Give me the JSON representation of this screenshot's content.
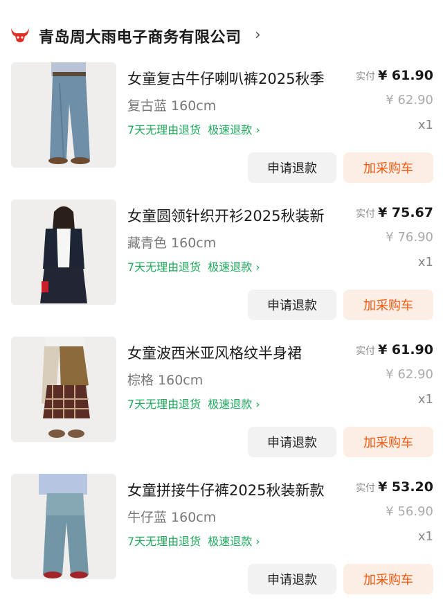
{
  "store": {
    "name": "青岛周大雨电子商务有限公司",
    "chevron": "›",
    "logo_icon": "bull-head-icon",
    "brand_color": "#e02e24"
  },
  "colors": {
    "service_green": "#1ea85b",
    "cart_orange": "#f25a12",
    "cart_bg": "#fdeee5"
  },
  "items": [
    {
      "title": "女童复古牛仔喇叭裤2025秋季",
      "spec": "复古蓝 160cm",
      "service": "7天无理由退货",
      "fast_refund": "极速退款 ›",
      "pay_label": "实付",
      "pay_price": "¥ 61.90",
      "orig_price": "¥ 62.90",
      "qty": "x1",
      "refund_label": "申请退款",
      "cart_label": "加采购车"
    },
    {
      "title": "女童圆领针织开衫2025秋装新",
      "spec": "藏青色 160cm",
      "service": "7天无理由退货",
      "fast_refund": "极速退款 ›",
      "pay_label": "实付",
      "pay_price": "¥ 75.67",
      "orig_price": "¥ 76.90",
      "qty": "x1",
      "refund_label": "申请退款",
      "cart_label": "加采购车"
    },
    {
      "title": "女童波西米亚风格纹半身裙",
      "spec": "棕格 160cm",
      "service": "7天无理由退货",
      "fast_refund": "极速退款 ›",
      "pay_label": "实付",
      "pay_price": "¥ 61.90",
      "orig_price": "¥ 62.90",
      "qty": "x1",
      "refund_label": "申请退款",
      "cart_label": "加采购车"
    },
    {
      "title": "女童拼接牛仔裤2025秋装新款",
      "spec": "牛仔蓝 160cm",
      "service": "7天无理由退货",
      "fast_refund": "极速退款 ›",
      "pay_label": "实付",
      "pay_price": "¥ 53.20",
      "orig_price": "¥ 56.90",
      "qty": "x1",
      "refund_label": "申请退款",
      "cart_label": "加采购车"
    }
  ]
}
